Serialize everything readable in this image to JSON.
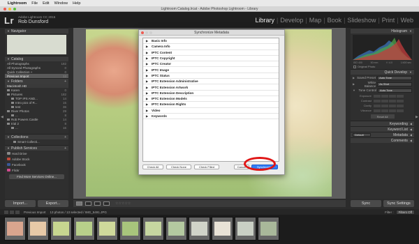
{
  "menubar": {
    "apple": "",
    "app": "Lightroom",
    "items": [
      "File",
      "Edit",
      "Window",
      "Help"
    ],
    "status": "Lightroom Catalog.lrcat - Adobe Photoshop Lightroom - Library"
  },
  "window": {
    "title": "Lightroom Catalog.lrcat - Adobe Photoshop Lightroom - Library"
  },
  "identity": {
    "logo": "Lr",
    "product": "Adobe Lightroom CC 2015",
    "name": "Rob Dunsford"
  },
  "modules": [
    "Library",
    "Develop",
    "Map",
    "Book",
    "Slideshow",
    "Print",
    "Web"
  ],
  "left": {
    "navigator": "Navigator",
    "catalog": {
      "header": "Catalog",
      "items": [
        {
          "label": "All Photographs",
          "count": "182"
        },
        {
          "label": "All Synced Photographs",
          "count": "0"
        },
        {
          "label": "Quick Collection +",
          "count": "0"
        },
        {
          "label": "Previous Import",
          "count": "13"
        }
      ]
    },
    "folders": {
      "header": "Folders",
      "drive": "Macintosh HD",
      "items": [
        {
          "label": "Karen",
          "count": "0"
        },
        {
          "label": "Pictures",
          "count": "182"
        },
        {
          "label": "TOP IPS AND...",
          "count": "14"
        },
        {
          "label": "Intro pics of R...",
          "count": "15"
        },
        {
          "label": "test",
          "count": "36"
        },
        {
          "label": "River Photos",
          "count": "29"
        },
        {
          "label": "...",
          "count": "8"
        },
        {
          "label": "Rob Powers Castle",
          "count": "14"
        },
        {
          "label": "trial 2",
          "count": "8"
        },
        {
          "label": "...",
          "count": "16"
        }
      ]
    },
    "collections": {
      "header": "Collections",
      "items": [
        {
          "label": "Smart Collecti...",
          "count": ""
        }
      ]
    },
    "publish": {
      "header": "Publish Services",
      "items": [
        {
          "label": "Hard Drive",
          "color": "#8a8a8a"
        },
        {
          "label": "Adobe Stock",
          "color": "#c14a3a"
        },
        {
          "label": "Facebook",
          "color": "#3b5998"
        },
        {
          "label": "Flickr",
          "color": "#d14b8f"
        }
      ],
      "find": "Find More Services Online..."
    },
    "import": "Import...",
    "export": "Export..."
  },
  "right": {
    "histogram": "Histogram",
    "readout": [
      "ISO 400",
      "50 mm",
      "f / 4.0",
      "1/400 sec"
    ],
    "original": "Original Photo",
    "quick_develop": "Quick Develop",
    "saved_preset_label": "Saved Preset",
    "saved_preset_value": "Auto Tone",
    "white_balance_label": "White Balance",
    "white_balance_value": "As Shot",
    "tone_control_label": "Tone Control",
    "tone_control_value": "Auto Tone",
    "tone_rows": [
      "Exposure",
      "Contrast",
      "Clarity",
      "Vibrance"
    ],
    "reset": "Reset All",
    "keywording": "Keywording",
    "keyword_list": "Keyword List",
    "metadata": "Metadata",
    "metadata_select": "Default",
    "comments": "Comments",
    "sync": "Sync",
    "sync_settings": "Sync Settings"
  },
  "dialog": {
    "title": "Synchronize Metadata",
    "sections": [
      "Basic Info",
      "Camera Info",
      "IPTC Content",
      "IPTC Copyright",
      "IPTC Creator",
      "IPTC Image",
      "IPTC Status",
      "IPTC Extension Administrative",
      "IPTC Extension Artwork",
      "IPTC Extension Description",
      "IPTC Extension Models",
      "IPTC Extension Rights",
      "Video",
      "Keywords"
    ],
    "check_all": "Check All",
    "check_none": "Check None",
    "check_filled": "Check Filled",
    "cancel": "Cancel",
    "synchronize": "Synchronize"
  },
  "filmstrip": {
    "source": "Previous Import",
    "info": "13 photos / 13 selected / IMG_5491.JPG",
    "filter_label": "Filter :",
    "filter_value": "Filters Off",
    "thumbs": [
      {
        "fill": "#d9a58e"
      },
      {
        "fill": "#e7c9a7"
      },
      {
        "fill": "#c7d690"
      },
      {
        "fill": "#b8cf8a"
      },
      {
        "fill": "#cfd99b"
      },
      {
        "fill": "#a8c57c"
      },
      {
        "fill": "#c6d6a0"
      },
      {
        "fill": "#b4c9a0"
      },
      {
        "fill": "#d0d3c8"
      },
      {
        "fill": "#e8e2d6"
      },
      {
        "fill": "#c9cfc4"
      },
      {
        "fill": "#a9b89a"
      }
    ]
  }
}
